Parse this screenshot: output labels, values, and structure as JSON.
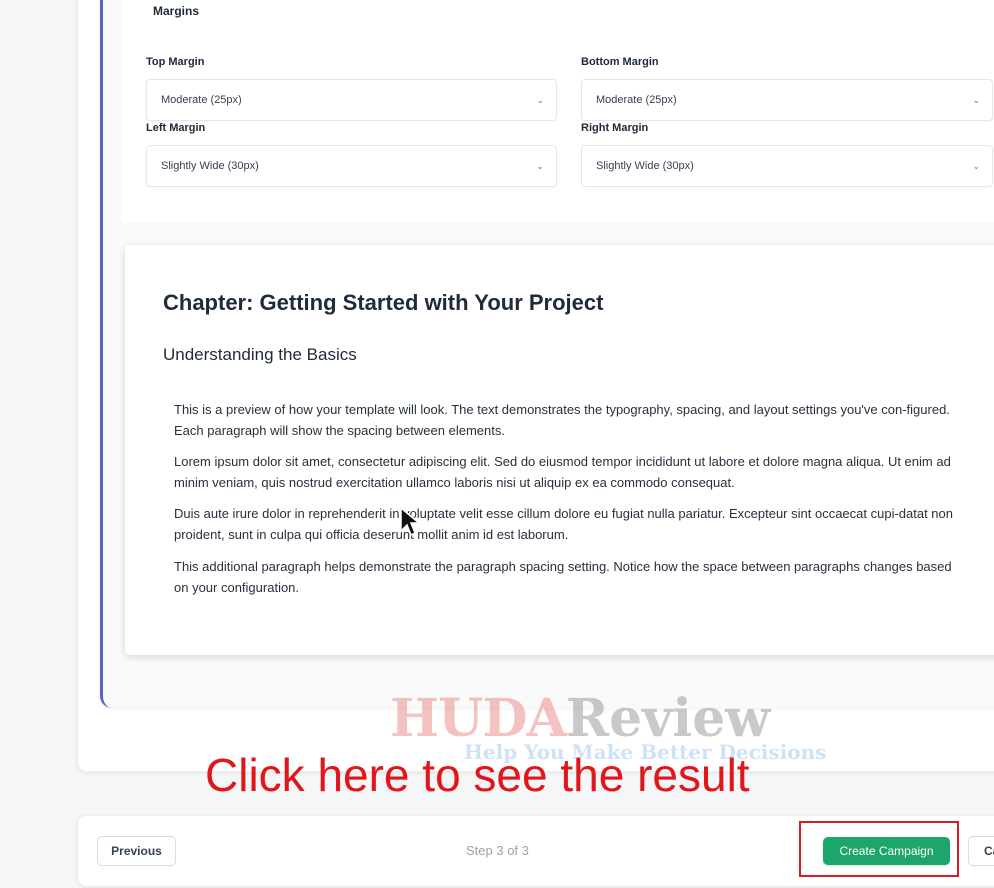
{
  "margins": {
    "section_title": "Margins",
    "top": {
      "label": "Top Margin",
      "value": "Moderate (25px)"
    },
    "bottom": {
      "label": "Bottom Margin",
      "value": "Moderate (25px)"
    },
    "left": {
      "label": "Left Margin",
      "value": "Slightly Wide (30px)"
    },
    "right": {
      "label": "Right Margin",
      "value": "Slightly Wide (30px)"
    },
    "chevron": "⌄"
  },
  "preview": {
    "chapter_title": "Chapter: Getting Started with Your Project",
    "subheading": "Understanding the Basics",
    "paragraphs": [
      "This is a preview of how your template will look. The text demonstrates the typography, spacing, and layout settings you've con-figured. Each paragraph will show the spacing between elements.",
      "Lorem ipsum dolor sit amet, consectetur adipiscing elit. Sed do eiusmod tempor incididunt ut labore et dolore magna aliqua. Ut enim ad minim veniam, quis nostrud exercitation ullamco laboris nisi ut aliquip ex ea commodo consequat.",
      "Duis aute irure dolor in reprehenderit in voluptate velit esse cillum dolore eu fugiat nulla pariatur. Excepteur sint occaecat cupi-datat non proident, sunt in culpa qui officia deserunt mollit anim id est laborum.",
      "This additional paragraph helps demonstrate the paragraph spacing setting. Notice how the space between paragraphs changes based on your configuration."
    ]
  },
  "watermark": {
    "brand_a": "HUDA",
    "brand_b": "Review",
    "tagline": "Help You Make Better Decisions"
  },
  "annotation": {
    "text": "Click here to see the result",
    "color": "#e0161b"
  },
  "footer": {
    "previous_label": "Previous",
    "step_text": "Step 3 of 3",
    "create_label": "Create Campaign",
    "cancel_label": "Cancel"
  },
  "colors": {
    "accent_border": "#5b63c9",
    "create_button": "#1ea56b",
    "highlight": "#d81b22"
  }
}
